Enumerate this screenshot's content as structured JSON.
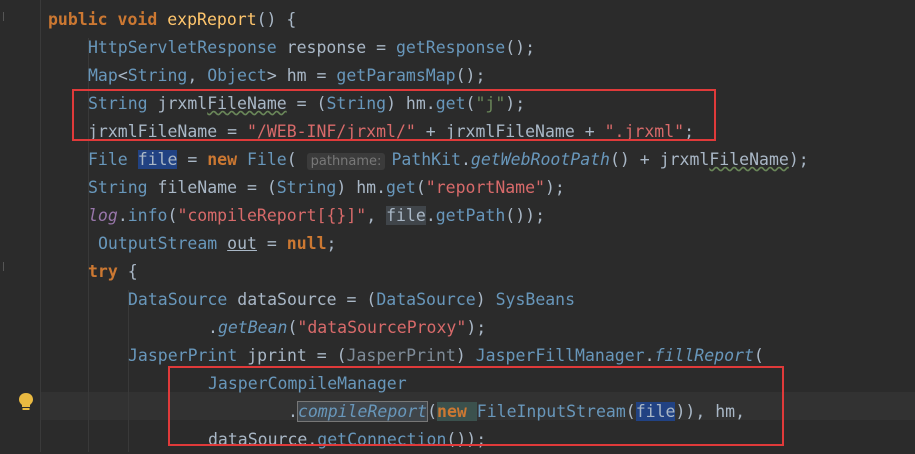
{
  "editor": {
    "lines": [
      "public void expReport() {",
      "HttpServletResponse response = getResponse();",
      "Map<String, Object> hm = getParamsMap();",
      "String jrxmlFileName = (String) hm.get(\"j\");",
      "jrxmlFileName = \"/WEB-INF/jrxml/\" + jrxmlFileName + \".jrxml\";",
      "File file = new File( pathname: PathKit.getWebRootPath() + jrxmlFileName);",
      "String fileName = (String) hm.get(\"reportName\");",
      "log.info(\"compileReport[{}]\", file.getPath());",
      "OutputStream out = null;",
      "try {",
      "DataSource dataSource = (DataSource) SysBeans",
      ".getBean(\"dataSourceProxy\");",
      "JasperPrint jprint = (JasperPrint) JasperFillManager.fillReport(",
      "JasperCompileManager",
      ".compileReport(new FileInputStream(file)), hm,",
      "dataSource.getConnection());"
    ],
    "hint_label": "pathname:",
    "colors": {
      "keyword": "#cc7832",
      "string": "#6a8759",
      "type": "#6897bb",
      "method": "#ffc66d",
      "highlight_box": "#e03a3a"
    },
    "icons": [
      "lightbulb-icon",
      "fold-marker-icon"
    ]
  }
}
